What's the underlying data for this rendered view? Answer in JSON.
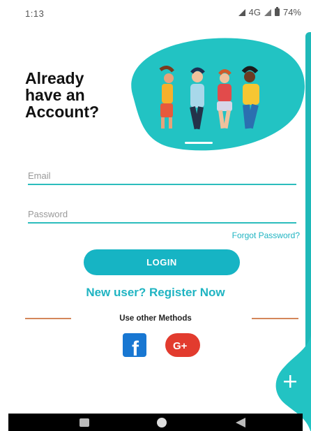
{
  "status_bar": {
    "time": "1:13",
    "network": "4G",
    "battery": "74%"
  },
  "heading": {
    "line1": "Already",
    "line2": "have an",
    "line3": "Account?"
  },
  "form": {
    "email_placeholder": "Email",
    "password_placeholder": "Password",
    "forgot_label": "Forgot Password?",
    "login_label": "LOGIN",
    "register_label": "New user? Register Now"
  },
  "social": {
    "other_methods_label": "Use other Methods",
    "facebook_glyph": "f",
    "google_glyph": "G+"
  },
  "fab": {
    "icon": "plus-icon"
  },
  "colors": {
    "accent": "#1fb9b9",
    "button": "#16b4c4",
    "link": "#1fb4c2",
    "divider": "#d4875a",
    "facebook": "#1877d2",
    "google": "#e23b2e"
  }
}
